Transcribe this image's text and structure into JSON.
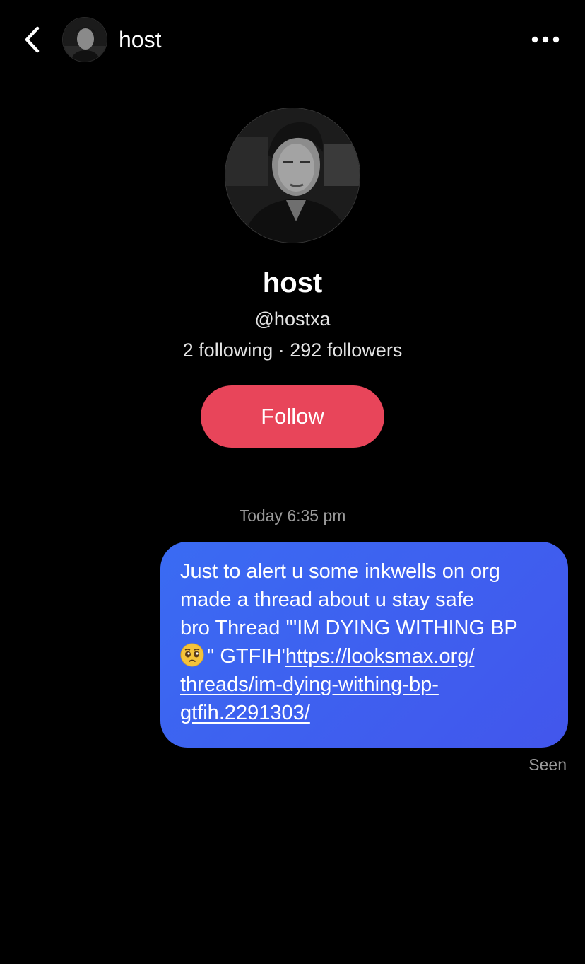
{
  "header": {
    "title": "host",
    "back_icon": "chevron-left-icon",
    "more_icon": "more-horizontal-icon"
  },
  "profile": {
    "name": "host",
    "handle": "@hostxa",
    "stats": "2 following · 292 followers",
    "follow_label": "Follow",
    "follow_color": "#e8455a"
  },
  "conversation": {
    "timestamp": "Today 6:35 pm",
    "message": {
      "line1": "Just to alert u some inkwells on org",
      "line2": "made a thread about u stay safe",
      "line3": "bro Thread '\"IM DYING WITHING BP",
      "line4_text": "\" GTFIH'",
      "emoji": "pleading-face-emoji",
      "link_part1": "https://looksmax.org/",
      "link_part2": "threads/im-dying-withing-bp-",
      "link_part3": "gtfih.2291303/",
      "bubble_color": "#3f5ff0"
    },
    "status": "Seen"
  }
}
